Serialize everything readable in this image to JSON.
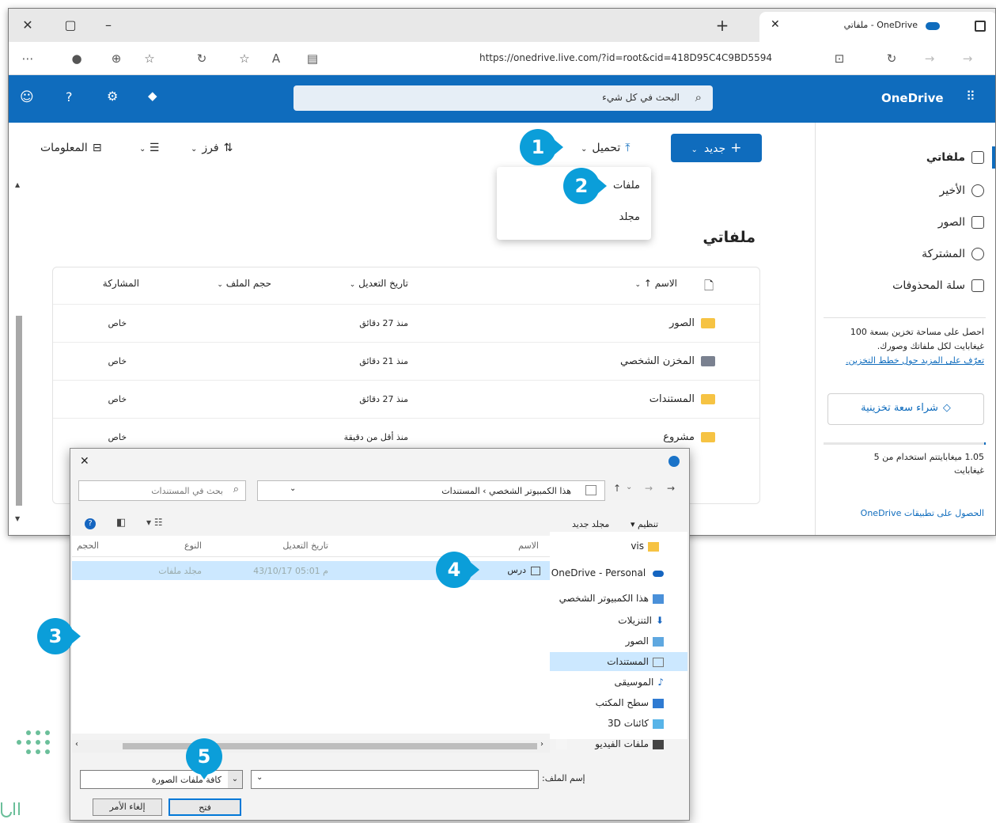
{
  "browser": {
    "tab_title": "OneDrive - ملفاتي",
    "url": "https://onedrive.live.com/?id=root&cid=418D95C4C9BD5594"
  },
  "onedrive": {
    "brand": "OneDrive",
    "search_placeholder": "البحث في كل شيء",
    "sidebar": {
      "items": [
        {
          "label": "ملفاتي"
        },
        {
          "label": "الأخير"
        },
        {
          "label": "الصور"
        },
        {
          "label": "المشتركة"
        },
        {
          "label": "سلة المحذوفات"
        }
      ],
      "promo_line1": "احصل على مساحة تخزين بسعة 100",
      "promo_line2": "غيغابايت لكل ملفاتك وصورك.",
      "promo_link": "تعرّف على المزيد حول خطط التخزين.",
      "buy_button": "شراء سعة تخزينية",
      "usage_line1": "1.05 ميغابايتتم استخدام من 5",
      "usage_line2": "غيغابايت",
      "apps_link": "الحصول على تطبيقات OneDrive"
    },
    "toolbar": {
      "new": "جديد",
      "upload": "تحميل",
      "sort": "فرز",
      "info": "المعلومات"
    },
    "upload_menu": [
      "ملفات",
      "مجلد"
    ],
    "page_title": "ملفاتي",
    "columns": {
      "name": "الاسم ↑",
      "modified": "تاريخ التعديل",
      "size": "حجم الملف",
      "sharing": "المشاركة"
    },
    "rows": [
      {
        "name": "الصور",
        "modified": "منذ 27 دقائق",
        "sharing": "خاص"
      },
      {
        "name": "المخزن الشخصي",
        "modified": "منذ 21 دقائق",
        "sharing": "خاص"
      },
      {
        "name": "المستندات",
        "modified": "منذ 27 دقائق",
        "sharing": "خاص"
      },
      {
        "name": "مشروع",
        "modified": "منذ أقل من دقيقة",
        "sharing": "خاص"
      }
    ]
  },
  "dialog": {
    "breadcrumb": "هذا الكمبيوتر الشخصي  ›  المستندات",
    "search_placeholder": "بحث في المستندات",
    "organize": "تنظيم",
    "new_folder": "مجلد جديد",
    "columns": {
      "name": "الاسم",
      "modified": "تاريخ التعديل",
      "type": "النوع",
      "size": "الحجم"
    },
    "file": {
      "name": "درس",
      "modified": "43/10/17 م 05:01",
      "type": "مجلد ملفات"
    },
    "tree": [
      "vis",
      "OneDrive - Personal",
      "هذا الكمبيوتر الشخصي",
      "التنزيلات",
      "الصور",
      "المستندات",
      "الموسيقى",
      "سطح المكتب",
      "كائنات 3D",
      "ملفات الفيديو"
    ],
    "filename_label": "إسم الملف:",
    "filetype": "كافة ملفات الصورة",
    "open": "فتح",
    "cancel": "إلغاء الأمر"
  },
  "steps": [
    "1",
    "2",
    "3",
    "4",
    "5"
  ],
  "colors": {
    "accent": "#0f6cbd",
    "badge": "#0b9ed9",
    "folder": "#f6c343"
  }
}
